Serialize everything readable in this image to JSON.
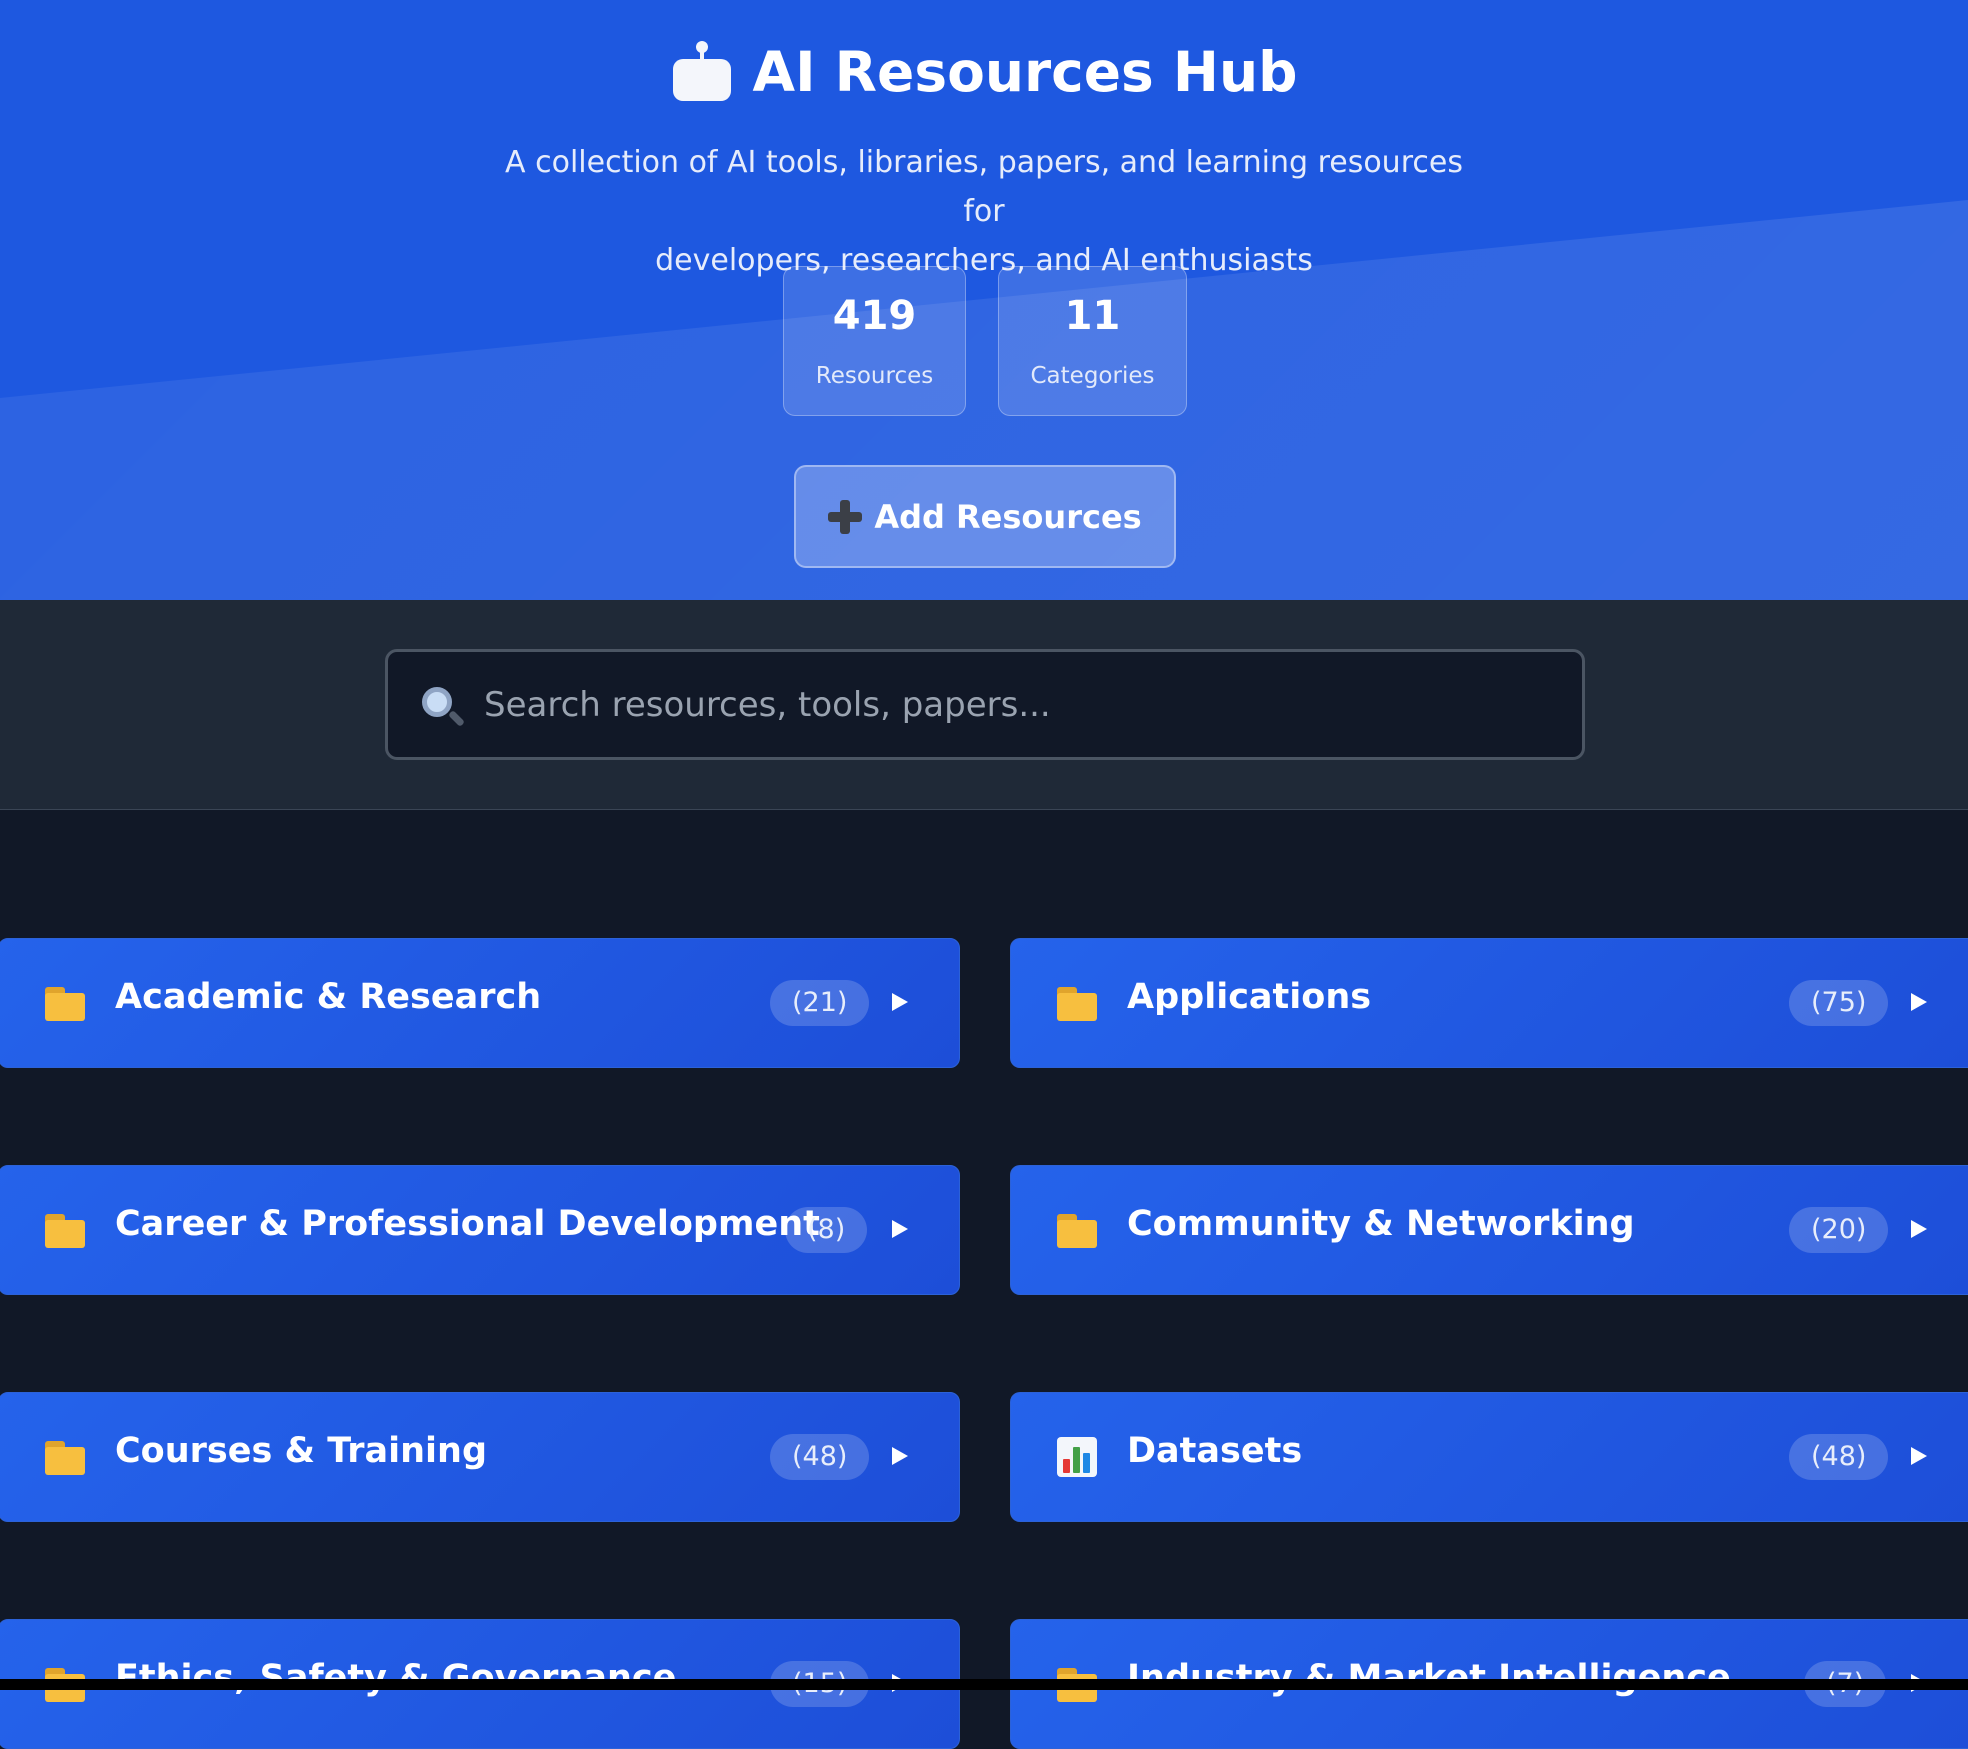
{
  "header": {
    "icon": "robot-icon",
    "title": "AI Resources Hub",
    "subtitle_line1": "A collection of AI tools, libraries, papers, and learning resources for",
    "subtitle_line2": "developers, researchers, and AI enthusiasts"
  },
  "stats": [
    {
      "value": "419",
      "label": "Resources"
    },
    {
      "value": "11",
      "label": "Categories"
    }
  ],
  "actions": {
    "add_icon": "plus-icon",
    "add_label": "Add Resources"
  },
  "search": {
    "icon": "search-icon",
    "placeholder": "Search resources, tools, papers...",
    "value": ""
  },
  "categories": [
    {
      "icon": "folder-icon",
      "label": "Academic & Research",
      "count": "(21)"
    },
    {
      "icon": "folder-icon",
      "label": "Applications",
      "count": "(75)"
    },
    {
      "icon": "folder-icon",
      "label": "Career & Professional Development",
      "count": "(8)"
    },
    {
      "icon": "folder-icon",
      "label": "Community & Networking",
      "count": "(20)"
    },
    {
      "icon": "folder-icon",
      "label": "Courses & Training",
      "count": "(48)"
    },
    {
      "icon": "bar-chart-icon",
      "label": "Datasets",
      "count": "(48)"
    },
    {
      "icon": "folder-icon",
      "label": "Ethics, Safety & Governance",
      "count": "(15)"
    },
    {
      "icon": "folder-icon",
      "label": "Industry & Market Intelligence",
      "count": "(7)"
    }
  ],
  "colors": {
    "hero_blue": "#1e58e0",
    "card_blue": "#2563eb",
    "page_bg": "#111827",
    "search_band": "#1f2937"
  }
}
